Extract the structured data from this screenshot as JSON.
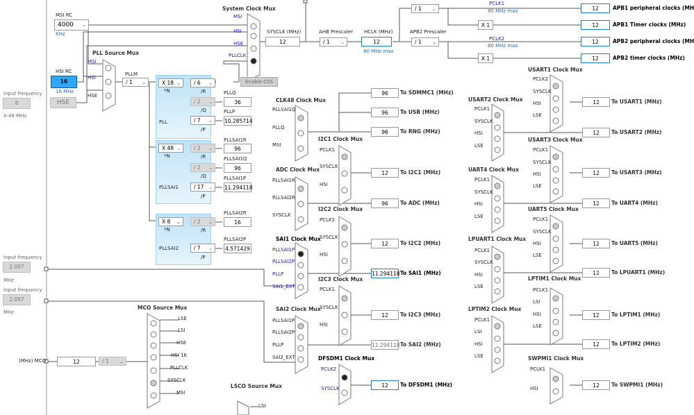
{
  "sysmux_title": "System Clock Mux",
  "msirc_title": "MSI RC",
  "msirc_value": "4000",
  "msirc_unit": "KHz",
  "hsirc_title": "HSI RC",
  "hsirc_value": "16",
  "hsirc_unit": "16 MHz",
  "pllsrc_title": "PLL Source Mux",
  "input_freq": "Input frequency",
  "hse_value": "8",
  "hse_label": "HSE",
  "hse_range": "4-48 MHz",
  "lse_value": "2.097",
  "lse_unit": "MHz",
  "lsi_value": "2.097",
  "lsi_unit": "MHz",
  "pllm_label": "PLLM",
  "pllm_value": "/ 1",
  "sysmux_inputs": [
    "MSI",
    "HSI",
    "HSE",
    "PLLCLK"
  ],
  "sysclk_label": "SYSCLK (MHz)",
  "sysclk_value": "12",
  "ahb_label": "AHB Prescaler",
  "ahb_value": "/ 1",
  "hclk_label": "HCLK (MHz)",
  "hclk_value": "12",
  "hclk_max": "80 MHz max",
  "apb2pre_label": "APB2 Prescaler",
  "apb2pre_value": "/ 1",
  "apb1pre_value": "/ 1",
  "enable_css": "Enable CSS",
  "pclk1_label": "PCLK1",
  "pclk1_max": "80 MHz max",
  "pclk2_label": "PCLK2",
  "pclk2_max": "80 MHz max",
  "x1": "X 1",
  "apb1_periph_value": "12",
  "apb1_periph_label": "APB1 peripheral clocks (MHz)",
  "apb1_timer_value": "12",
  "apb1_timer_label": "APB1 Timer clocks (MHz)",
  "apb2_periph_value": "12",
  "apb2_periph_label": "APB2 peripheral clocks (MHz)",
  "apb2_timer_value": "12",
  "apb2_timer_label": "APB2 timer clocks (MHz)",
  "pll": {
    "n": "X 18",
    "n_label": "*N",
    "r": "/ 6",
    "r_label": "/R",
    "q": "/ 2",
    "q_label": "/Q",
    "p": "/ 7",
    "p_label": "/P",
    "name": "PLL",
    "pllq": "PLLQ",
    "pllq_val": "36",
    "pllp": "PLLP",
    "pllp_val": "10.285714"
  },
  "sai1": {
    "n": "X 48",
    "n_label": "*N",
    "r": "/ 2",
    "r_label": "/R",
    "q": "/ 2",
    "q_label": "/Q",
    "p": "/ 17",
    "p_label": "/P",
    "name": "PLLSAI1",
    "r_out": "PLLSAI1R",
    "r_val": "96",
    "q_out": "PLLSAI1Q",
    "q_val": "96",
    "p_out": "PLLSAI1P",
    "p_val": "11.294118"
  },
  "sai2": {
    "n": "X 8",
    "n_label": "*N",
    "r": "/ 2",
    "r_label": "/R",
    "p": "/ 7",
    "p_label": "/P",
    "name": "PLLSAI2",
    "r_out": "PLLSAI2R",
    "r_val": "16",
    "p_out": "PLLSAI2P",
    "p_val": "4.571429"
  },
  "clk48": {
    "title": "CLK48 Clock Mux",
    "inputs": [
      "PLLSAI1Q",
      "PLLQ",
      "MSI"
    ],
    "sdmmc_val": "96",
    "sdmmc": "To SDMMC1 (MHz)",
    "usb_val": "96",
    "usb": "To USB (MHz)",
    "rng_val": "96",
    "rng": "To RNG (MHz)"
  },
  "adc": {
    "title": "ADC Clock Mux",
    "inputs": [
      "PLLSAI1R",
      "PLLSAI2R",
      "SYSCLK"
    ],
    "val": "96",
    "out": "To ADC (MHz)"
  },
  "i2c1": {
    "title": "I2C1 Clock Mux",
    "inputs": [
      "PCLK1",
      "SYSCLK",
      "HSI"
    ],
    "val": "12",
    "out": "To I2C1 (MHz)"
  },
  "i2c2": {
    "title": "I2C2 Clock Mux",
    "inputs": [
      "PCLK1",
      "SYSCLK",
      "HSI"
    ],
    "val": "12",
    "out": "To I2C2 (MHz)"
  },
  "i2c3": {
    "title": "I2C3 Clock Mux",
    "inputs": [
      "PCLK1",
      "SYSCLK",
      "HSI"
    ],
    "val": "12",
    "out": "To I2C3 (MHz)"
  },
  "sai1mux": {
    "title": "SAI1 Clock Mux",
    "inputs": [
      "PLLSAI1P",
      "PLLSAI2P",
      "PLLP",
      "SAI1_EXT"
    ],
    "val": "11.294118",
    "out": "To SAI1 (MHz)"
  },
  "sai2mux": {
    "title": "SAI2 Clock Mux",
    "inputs": [
      "PLLSAI1P",
      "PLLSAI2P",
      "PLLP",
      "SAI2_EXT"
    ],
    "val": "11.294118",
    "out": "To SAI2 (MHz)"
  },
  "dfsdm": {
    "title": "DFSDM1 Clock Mux",
    "inputs": [
      "PCLK2",
      "SYSCLK"
    ],
    "val": "12",
    "out": "To DFSDM1 (MHz)"
  },
  "mco": {
    "title": "MCO Source Mux",
    "inputs": [
      "LSE",
      "LSI",
      "HSE",
      "HSI 16",
      "PLLCLK",
      "SYSCLK",
      "MSI"
    ],
    "out": "(MHz) MCO",
    "val": "12",
    "div": "/ 1"
  },
  "lsco": {
    "title": "LSCO Source Mux",
    "input": "LSI"
  },
  "usart1": {
    "title": "USART1 Clock Mux",
    "inputs": [
      "PCLK2",
      "SYSCLK",
      "HSI",
      "LSE"
    ],
    "val": "12",
    "out": "To USART1 (MHz)"
  },
  "usart2": {
    "title": "USART2 Clock Mux",
    "inputs": [
      "PCLK1",
      "SYSCLK",
      "HSI",
      "LSE"
    ],
    "val": "12",
    "out": "To USART2 (MHz)"
  },
  "usart3": {
    "title": "USART3 Clock Mux",
    "inputs": [
      "PCLK1",
      "SYSCLK",
      "HSI",
      "LSE"
    ],
    "val": "12",
    "out": "To USART3 (MHz)"
  },
  "uart4": {
    "title": "UART4 Clock Mux",
    "inputs": [
      "PCLK1",
      "SYSCLK",
      "HSI",
      "LSE"
    ],
    "val": "12",
    "out": "To UART4 (MHz)"
  },
  "uart5": {
    "title": "UART5 Clock Mux",
    "inputs": [
      "PCLK1",
      "SYSCLK",
      "HSI",
      "LSE"
    ],
    "val": "12",
    "out": "To UART5 (MHz)"
  },
  "lpuart1": {
    "title": "LPUART1 Clock Mux",
    "inputs": [
      "PCLK1",
      "SYSCLK",
      "HSI",
      "LSE"
    ],
    "val": "12",
    "out": "To LPUART1 (MHz)"
  },
  "lptim1": {
    "title": "LPTIM1 Clock Mux",
    "inputs": [
      "PCLK1",
      "LSI",
      "HSI",
      "LSE"
    ],
    "val": "12",
    "out": "To LPTIM1 (MHz)"
  },
  "lptim2": {
    "title": "LPTIM2 Clock Mux",
    "inputs": [
      "PCLK1",
      "LSI",
      "HSI",
      "LSE"
    ],
    "val": "12",
    "out": "To LPTIM2 (MHz)"
  },
  "swpmi1": {
    "title": "SWPMI1 Clock Mux",
    "inputs": [
      "PCLK1",
      "HSI"
    ],
    "val": "12",
    "out": "To SWPMI1 (MHz)"
  }
}
